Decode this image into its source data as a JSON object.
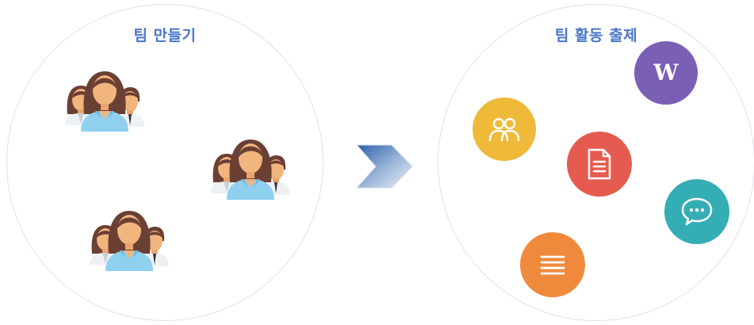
{
  "left_panel": {
    "title": "팀 만들기",
    "groups": [
      "team-group",
      "team-group",
      "team-group"
    ]
  },
  "right_panel": {
    "title": "팀 활동 출제",
    "badges": [
      {
        "name": "wiki-badge",
        "icon": "wiki-icon",
        "letter": "W",
        "color": "#7b5fb5"
      },
      {
        "name": "people-badge",
        "icon": "people-icon",
        "color": "#efb93a"
      },
      {
        "name": "document-badge",
        "icon": "document-icon",
        "color": "#e65b4f"
      },
      {
        "name": "chat-badge",
        "icon": "chat-bubble-icon",
        "color": "#35adb4"
      },
      {
        "name": "list-badge",
        "icon": "list-icon",
        "color": "#ef8a3c"
      }
    ]
  },
  "arrow": {
    "icon": "chevron-right-icon",
    "colors": [
      "#2f5fa8",
      "#eaf1f8"
    ]
  },
  "colors": {
    "title": "#4a78c8",
    "border": "#dfe2e6",
    "hair": "#6b4034",
    "skin": "#f2b57e",
    "shirt": "#8fd0ee"
  }
}
